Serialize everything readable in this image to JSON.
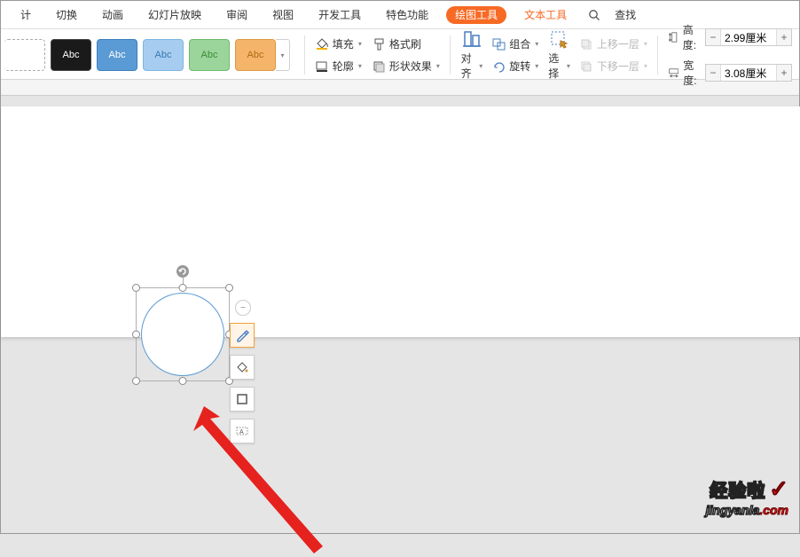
{
  "tabs": {
    "t0": "计",
    "t1": "切换",
    "t2": "动画",
    "t3": "幻灯片放映",
    "t4": "审阅",
    "t5": "视图",
    "t6": "开发工具",
    "t7": "特色功能",
    "active": "绘图工具",
    "text_tool": "文本工具",
    "search": "查找"
  },
  "styles": {
    "label": "Abc"
  },
  "shape": {
    "fill": "填充",
    "brush": "格式刷",
    "outline": "轮廓",
    "effect": "形状效果"
  },
  "arrange": {
    "align": "对齐",
    "group": "组合",
    "rotate": "旋转",
    "select": "选择",
    "up": "上移一层",
    "down": "下移一层"
  },
  "size": {
    "height_label": "高度:",
    "width_label": "宽度:",
    "height_val": "2.99厘米",
    "width_val": "3.08厘米"
  },
  "watermark": {
    "line1": "经验啦",
    "line2a": "jingyanla",
    "line2b": "com"
  }
}
